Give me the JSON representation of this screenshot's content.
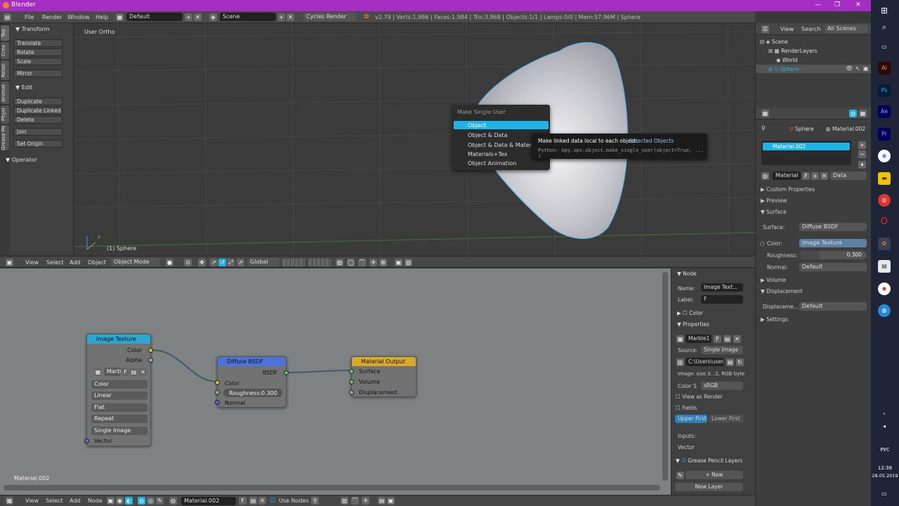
{
  "title": {
    "app": "Blender"
  },
  "menu": {
    "file": "File",
    "render": "Render",
    "window": "Window",
    "help": "Help",
    "layout": "Default",
    "scene": "Scene",
    "engine": "Cycles Render",
    "stats": "v2.79 | Verts:1,986 | Faces:1,984 | Tris:3,968 | Objects:1/1 | Lamps:0/0 | Mem:57.96M | Sphere"
  },
  "tabs": [
    "Too",
    "Crea",
    "Relati",
    "Animat",
    "Physi",
    "Grease Pe"
  ],
  "toolshelf": {
    "transform": "Transform",
    "translate": "Translate",
    "rotate": "Rotate",
    "scale": "Scale",
    "mirror": "Mirror",
    "edit": "Edit",
    "duplicate": "Duplicate",
    "duplicate_linked": "Duplicate Linked",
    "delete": "Delete",
    "join": "Join",
    "set_origin": "Set Origin",
    "operator": "Operator"
  },
  "viewport": {
    "view_label": "User Ortho",
    "object_label": "(1) Sphere",
    "axis_y": "y"
  },
  "popup": {
    "title": "Make Single User",
    "items": [
      "Object",
      "Object & Data",
      "Object & Data & Materials+",
      "Materials+Tex",
      "Object Animation"
    ]
  },
  "tooltip": {
    "label": "Make linked data local to each object:",
    "value": "Selected Objects",
    "python": "Python: bpy.ops.object.make_single_user(object=True, ... )"
  },
  "view3d_header": {
    "view": "View",
    "select": "Select",
    "add": "Add",
    "object": "Object",
    "mode": "Object Mode",
    "orientation": "Global"
  },
  "nodes": {
    "image_texture": {
      "title": "Image Texture",
      "out_color": "Color",
      "out_alpha": "Alpha",
      "image": "Marb",
      "f": "F",
      "color": "Color",
      "interp": "Linear",
      "proj": "Flat",
      "ext": "Repeat",
      "src": "Single Image",
      "vector": "Vector"
    },
    "diffuse": {
      "title": "Diffuse BSDF",
      "bsdf": "BSDF",
      "color": "Color",
      "roughness_label": "Roughness:",
      "roughness": "0.300",
      "normal": "Normal"
    },
    "output": {
      "title": "Material Output",
      "surface": "Surface",
      "volume": "Volume",
      "displacement": "Displacement"
    },
    "material_label": "Material.002"
  },
  "node_panel": {
    "node": "Node",
    "name_label": "Name:",
    "name": "Image Text...",
    "label_label": "Label:",
    "label_val": "F",
    "color": "Color",
    "properties": "Properties",
    "image": "Marble1",
    "f": "F",
    "source_label": "Source:",
    "source": "Single Image",
    "path": "C:\\Users\\user...",
    "info": "Image: size 3...2, RGB byte",
    "colorspace_label": "Color S",
    "colorspace": "sRGB",
    "view_as_render": "View as Render",
    "fields": "Fields",
    "upper_first": "Upper First",
    "lower_first": "Lower First",
    "inputs": "Inputs:",
    "vector": "Vector",
    "gp_layers": "Grease Pencil Layers",
    "new": "New",
    "new_layer": "New Layer"
  },
  "node_header": {
    "view": "View",
    "select": "Select",
    "add": "Add",
    "node": "Node",
    "material": "Material.002",
    "f": "F",
    "use_nodes": "Use Nodes"
  },
  "outliner": {
    "view": "View",
    "search": "Search",
    "all_scenes": "All Scenes",
    "scene": "Scene",
    "renderlayers": "RenderLayers",
    "world": "World",
    "sphere": "Sphere"
  },
  "props": {
    "sphere": "Sphere",
    "material": "Material.002",
    "slot": "Material.002",
    "mat_field": "Material",
    "f": "F",
    "data": "Data",
    "custom": "Custom Properties",
    "preview": "Preview",
    "surface": "Surface",
    "surface_label": "Surface:",
    "surface_val": "Diffuse BSDF",
    "color_label": "Color:",
    "color_val": "Image Texture",
    "roughness_label": "Roughness:",
    "roughness": "0.300",
    "normal_label": "Normal:",
    "normal": "Default",
    "volume": "Volume",
    "displacement": "Displacement",
    "disp_label": "Displaceme...",
    "disp_val": "Default",
    "settings": "Settings"
  },
  "taskbar": {
    "lang": "РУС",
    "time": "12:38",
    "date": "28.05.2019"
  },
  "colors": {
    "title": "#a42ec2",
    "select_blue": "#1fb3e6",
    "node_tex": "#2ea6d3",
    "node_shader": "#4d72d9",
    "node_output": "#d9a92c"
  }
}
